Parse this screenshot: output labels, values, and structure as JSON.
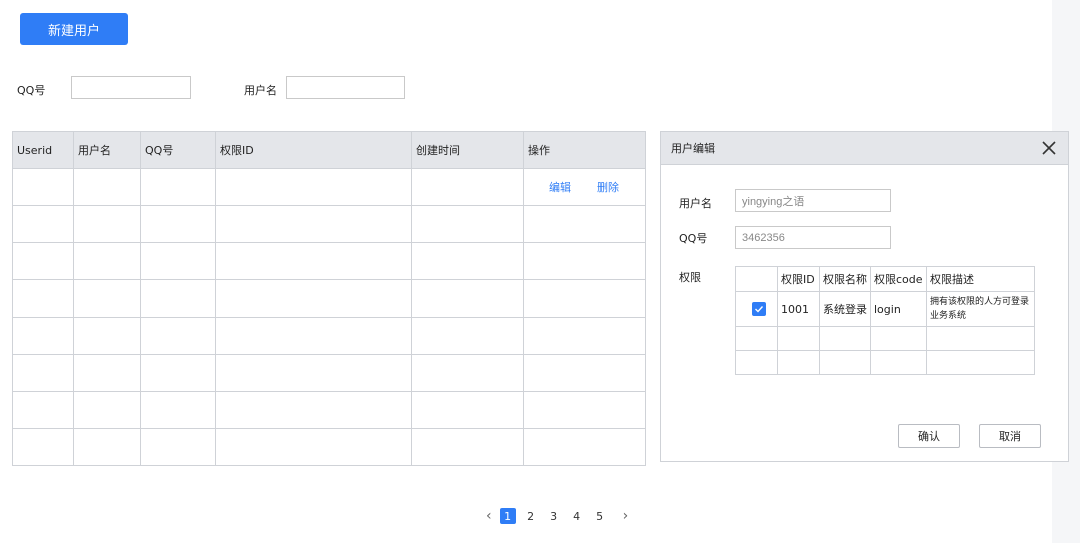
{
  "toolbar": {
    "new_user_label": "新建用户"
  },
  "filters": {
    "qq_label": "QQ号",
    "qq_value": "",
    "username_label": "用户名",
    "username_value": ""
  },
  "table": {
    "columns": [
      "Userid",
      "用户名",
      "QQ号",
      "权限ID",
      "创建时间",
      "操作"
    ],
    "row_actions": {
      "edit": "编辑",
      "delete": "删除"
    }
  },
  "pagination": {
    "prev_icon": "‹",
    "pages": [
      "1",
      "2",
      "3",
      "4",
      "5"
    ],
    "current": "1",
    "next_icon": "›"
  },
  "modal": {
    "title": "用户编辑",
    "username_label": "用户名",
    "username_value": "yingying之语",
    "qq_label": "QQ号",
    "qq_value": "3462356",
    "permission_label": "权限",
    "perm_columns": [
      "",
      "权限ID",
      "权限名称",
      "权限code",
      "权限描述"
    ],
    "perm_rows": [
      {
        "checked": true,
        "id": "1001",
        "name": "系统登录",
        "code": "login",
        "desc": "拥有该权限的人方可登录业务系统"
      }
    ],
    "confirm_label": "确认",
    "cancel_label": "取消"
  },
  "colors": {
    "accent": "#2f7df6",
    "header_bg": "#e4e6ea",
    "border": "#cfd2d7"
  }
}
